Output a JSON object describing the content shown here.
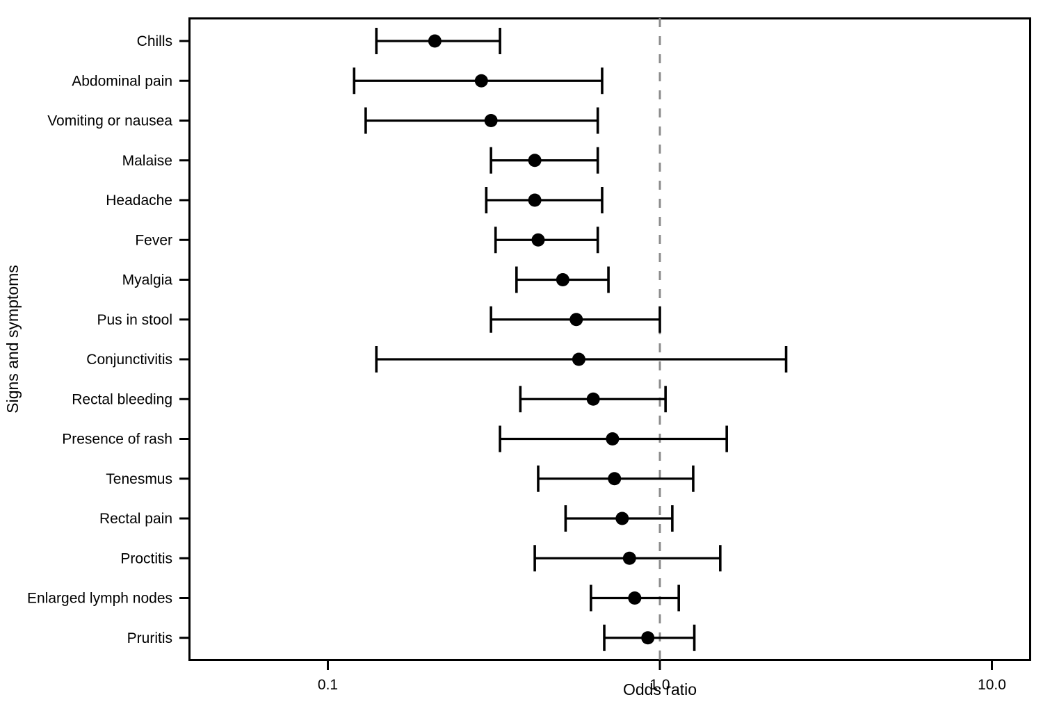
{
  "figure": {
    "axis": {
      "xlabel": "Odds ratio",
      "ylabel": "Signs and symptoms",
      "xticks": [
        "0.1",
        "1.0",
        "10.0"
      ]
    },
    "reference_line_value": "1.0"
  },
  "chart_data": {
    "type": "scatter",
    "plot_style": "forest-plot",
    "title": "",
    "xlabel": "Odds ratio",
    "ylabel": "Signs and symptoms",
    "xscale": "log10",
    "xlim": [
      0.05,
      13.0
    ],
    "xticks": [
      0.1,
      1.0,
      10.0
    ],
    "xtick_labels": [
      "0.1",
      "1.0",
      "10.0"
    ],
    "grid": false,
    "legend": null,
    "reference_line": 1.0,
    "reference_line_style": "dashed-gray",
    "marker": "filled-circle",
    "error_bars": "horizontal-capped-95CI",
    "categories": [
      "Chills",
      "Abdominal pain",
      "Vomiting or nausea",
      "Malaise",
      "Headache",
      "Fever",
      "Myalgia",
      "Pus in stool",
      "Conjunctivitis",
      "Rectal bleeding",
      "Presence of rash",
      "Tenesmus",
      "Rectal pain",
      "Proctitis",
      "Enlarged lymph nodes",
      "Pruritis"
    ],
    "values": [
      0.21,
      0.29,
      0.31,
      0.42,
      0.42,
      0.43,
      0.51,
      0.56,
      0.57,
      0.63,
      0.72,
      0.73,
      0.77,
      0.81,
      0.84,
      0.92
    ],
    "ci_low": [
      0.14,
      0.12,
      0.13,
      0.31,
      0.3,
      0.32,
      0.37,
      0.31,
      0.14,
      0.38,
      0.33,
      0.43,
      0.52,
      0.42,
      0.62,
      0.68
    ],
    "ci_high": [
      0.33,
      0.67,
      0.65,
      0.65,
      0.67,
      0.65,
      0.7,
      1.0,
      2.4,
      1.04,
      1.59,
      1.26,
      1.09,
      1.52,
      1.14,
      1.27
    ],
    "points": [
      {
        "label": "Chills",
        "or": 0.21,
        "low": 0.14,
        "high": 0.33
      },
      {
        "label": "Abdominal pain",
        "or": 0.29,
        "low": 0.12,
        "high": 0.67
      },
      {
        "label": "Vomiting or nausea",
        "or": 0.31,
        "low": 0.13,
        "high": 0.65
      },
      {
        "label": "Malaise",
        "or": 0.42,
        "low": 0.31,
        "high": 0.65
      },
      {
        "label": "Headache",
        "or": 0.42,
        "low": 0.3,
        "high": 0.67
      },
      {
        "label": "Fever",
        "or": 0.43,
        "low": 0.32,
        "high": 0.65
      },
      {
        "label": "Myalgia",
        "or": 0.51,
        "low": 0.37,
        "high": 0.7
      },
      {
        "label": "Pus in stool",
        "or": 0.56,
        "low": 0.31,
        "high": 1.0
      },
      {
        "label": "Conjunctivitis",
        "or": 0.57,
        "low": 0.14,
        "high": 2.4
      },
      {
        "label": "Rectal bleeding",
        "or": 0.63,
        "low": 0.38,
        "high": 1.04
      },
      {
        "label": "Presence of rash",
        "or": 0.72,
        "low": 0.33,
        "high": 1.59
      },
      {
        "label": "Tenesmus",
        "or": 0.73,
        "low": 0.43,
        "high": 1.26
      },
      {
        "label": "Rectal pain",
        "or": 0.77,
        "low": 0.52,
        "high": 1.09
      },
      {
        "label": "Proctitis",
        "or": 0.81,
        "low": 0.42,
        "high": 1.52
      },
      {
        "label": "Enlarged lymph nodes",
        "or": 0.84,
        "low": 0.62,
        "high": 1.14
      },
      {
        "label": "Pruritis",
        "or": 0.92,
        "low": 0.68,
        "high": 1.27
      }
    ]
  },
  "colors": {
    "marker": "#000000",
    "line": "#000000",
    "reference_line": "#8c8c8c",
    "frame": "#000000",
    "background": "#ffffff"
  }
}
